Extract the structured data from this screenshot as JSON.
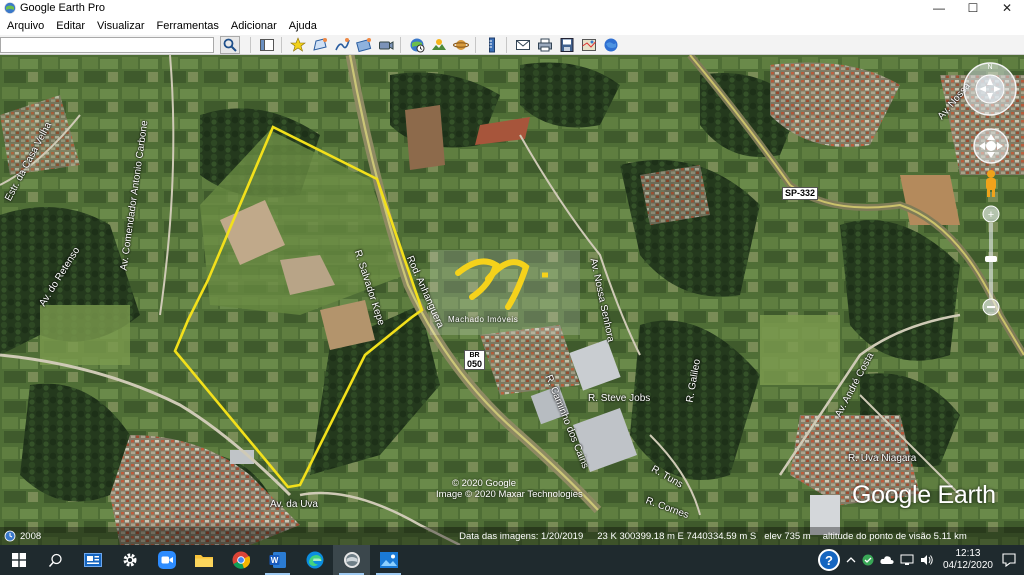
{
  "window": {
    "title": "Google Earth Pro",
    "minimize_glyph": "—",
    "maximize_glyph": "☐",
    "close_glyph": "✕"
  },
  "menu": {
    "items": [
      "Arquivo",
      "Editar",
      "Visualizar",
      "Ferramentas",
      "Adicionar",
      "Ajuda"
    ]
  },
  "toolbar": {
    "search_value": "",
    "buttons": [
      "search-icon",
      "sidebar-icon",
      "placemark-icon",
      "polygon-icon",
      "path-icon",
      "image-overlay-icon",
      "record-tour-icon",
      "historical-imagery-icon",
      "sunlight-icon",
      "planets-icon",
      "ruler-icon",
      "email-icon",
      "print-icon",
      "save-image-icon",
      "maps-icon",
      "earth-view-icon"
    ]
  },
  "map": {
    "polygon_color": "#f2e01b",
    "road_labels": {
      "estr_casa_velha": "Estr. da Casa Velha",
      "comendador": "Av. Comendador Antonio Carbone",
      "retenso": "Av. do Retenso",
      "salvador": "R. Salvador Kepe",
      "anhanguera": "Rod. Anhanguera",
      "nostra": "Av. Nossa Senhora",
      "uva": "Av. da Uva",
      "steve": "R. Steve Jobs",
      "galileo": "R. Galileo",
      "tuns": "R. Tuns",
      "cornes": "R. Cornes",
      "caminho": "R. Caminho dos Cains",
      "andre": "Av. André Costa",
      "uva_niagara": "R. Uva Niagara",
      "top_right": "Av. Nossa"
    },
    "shields": {
      "sp332": "SP-332",
      "br050": "050",
      "br_top": "BR"
    },
    "watermark_text": "Machado Imóveis",
    "logo": "Google Earth",
    "credits": [
      "© 2020 Google",
      "Image © 2020 Maxar Technologies"
    ]
  },
  "status": {
    "year_badge": "2008",
    "imagery_date": "Data das imagens: 1/20/2019",
    "coords": "23 K 300399.18 m E 7440334.59 m S",
    "elevation": "elev   735 m",
    "eye_alt": "altitude do ponto de visão   5.11 km"
  },
  "taskbar": {
    "apps": [
      "windows-start-icon",
      "search-icon",
      "news-icon",
      "settings-icon",
      "zoom-icon",
      "file-explorer-icon",
      "chrome-icon",
      "word-icon",
      "edge-icon",
      "google-earth-icon",
      "photos-icon"
    ],
    "time": "12:13",
    "date": "04/12/2020",
    "help_glyph": "?"
  }
}
